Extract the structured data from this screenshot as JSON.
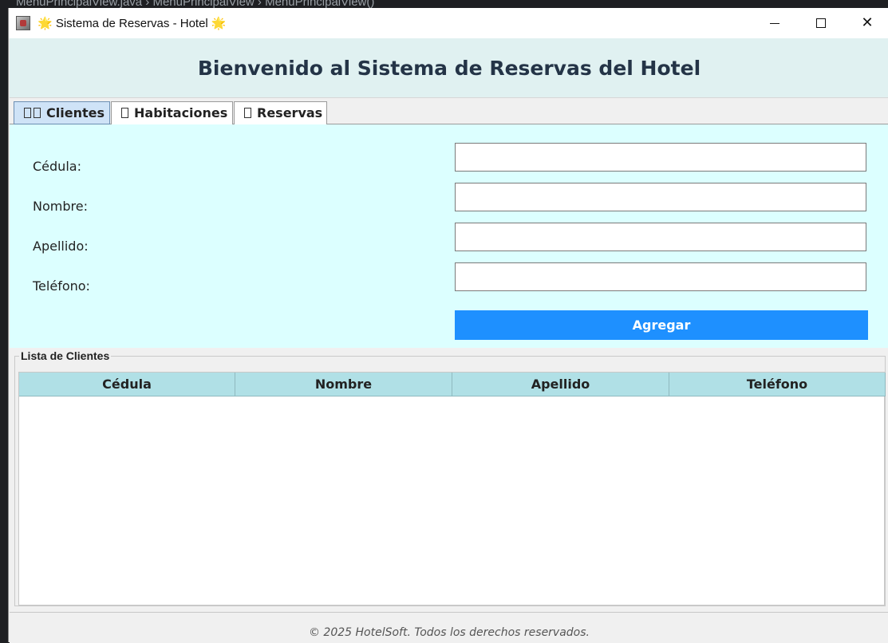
{
  "background": {
    "breadcrumb": "MenuPrincipalView.java  ›  MenuPrincipalView  ›  MenuPrincipalView()"
  },
  "window": {
    "title": "🌟 Sistema de Reservas - Hotel 🌟",
    "controls": {
      "minimize": "minimize-icon",
      "maximize": "maximize-icon",
      "close": "✕"
    }
  },
  "header": {
    "title": "Bienvenido al Sistema de Reservas del Hotel"
  },
  "tabs": [
    {
      "label": "Clientes",
      "icon": "people-icon",
      "selected": true
    },
    {
      "label": "Habitaciones",
      "icon": "bed-icon",
      "selected": false
    },
    {
      "label": "Reservas",
      "icon": "calendar-icon",
      "selected": false
    }
  ],
  "form": {
    "fields": [
      {
        "label": "Cédula:",
        "value": ""
      },
      {
        "label": "Nombre:",
        "value": ""
      },
      {
        "label": "Apellido:",
        "value": ""
      },
      {
        "label": "Teléfono:",
        "value": ""
      }
    ],
    "submit_label": "Agregar"
  },
  "list": {
    "title": "Lista de Clientes",
    "columns": [
      "Cédula",
      "Nombre",
      "Apellido",
      "Teléfono"
    ],
    "rows": []
  },
  "footer": {
    "text": "© 2025 HotelSoft. Todos los derechos reservados."
  },
  "colors": {
    "header_bg": "#e0f1f1",
    "form_bg": "#dcffff",
    "button_bg": "#1e90ff",
    "table_header_bg": "#b0e0e6"
  }
}
